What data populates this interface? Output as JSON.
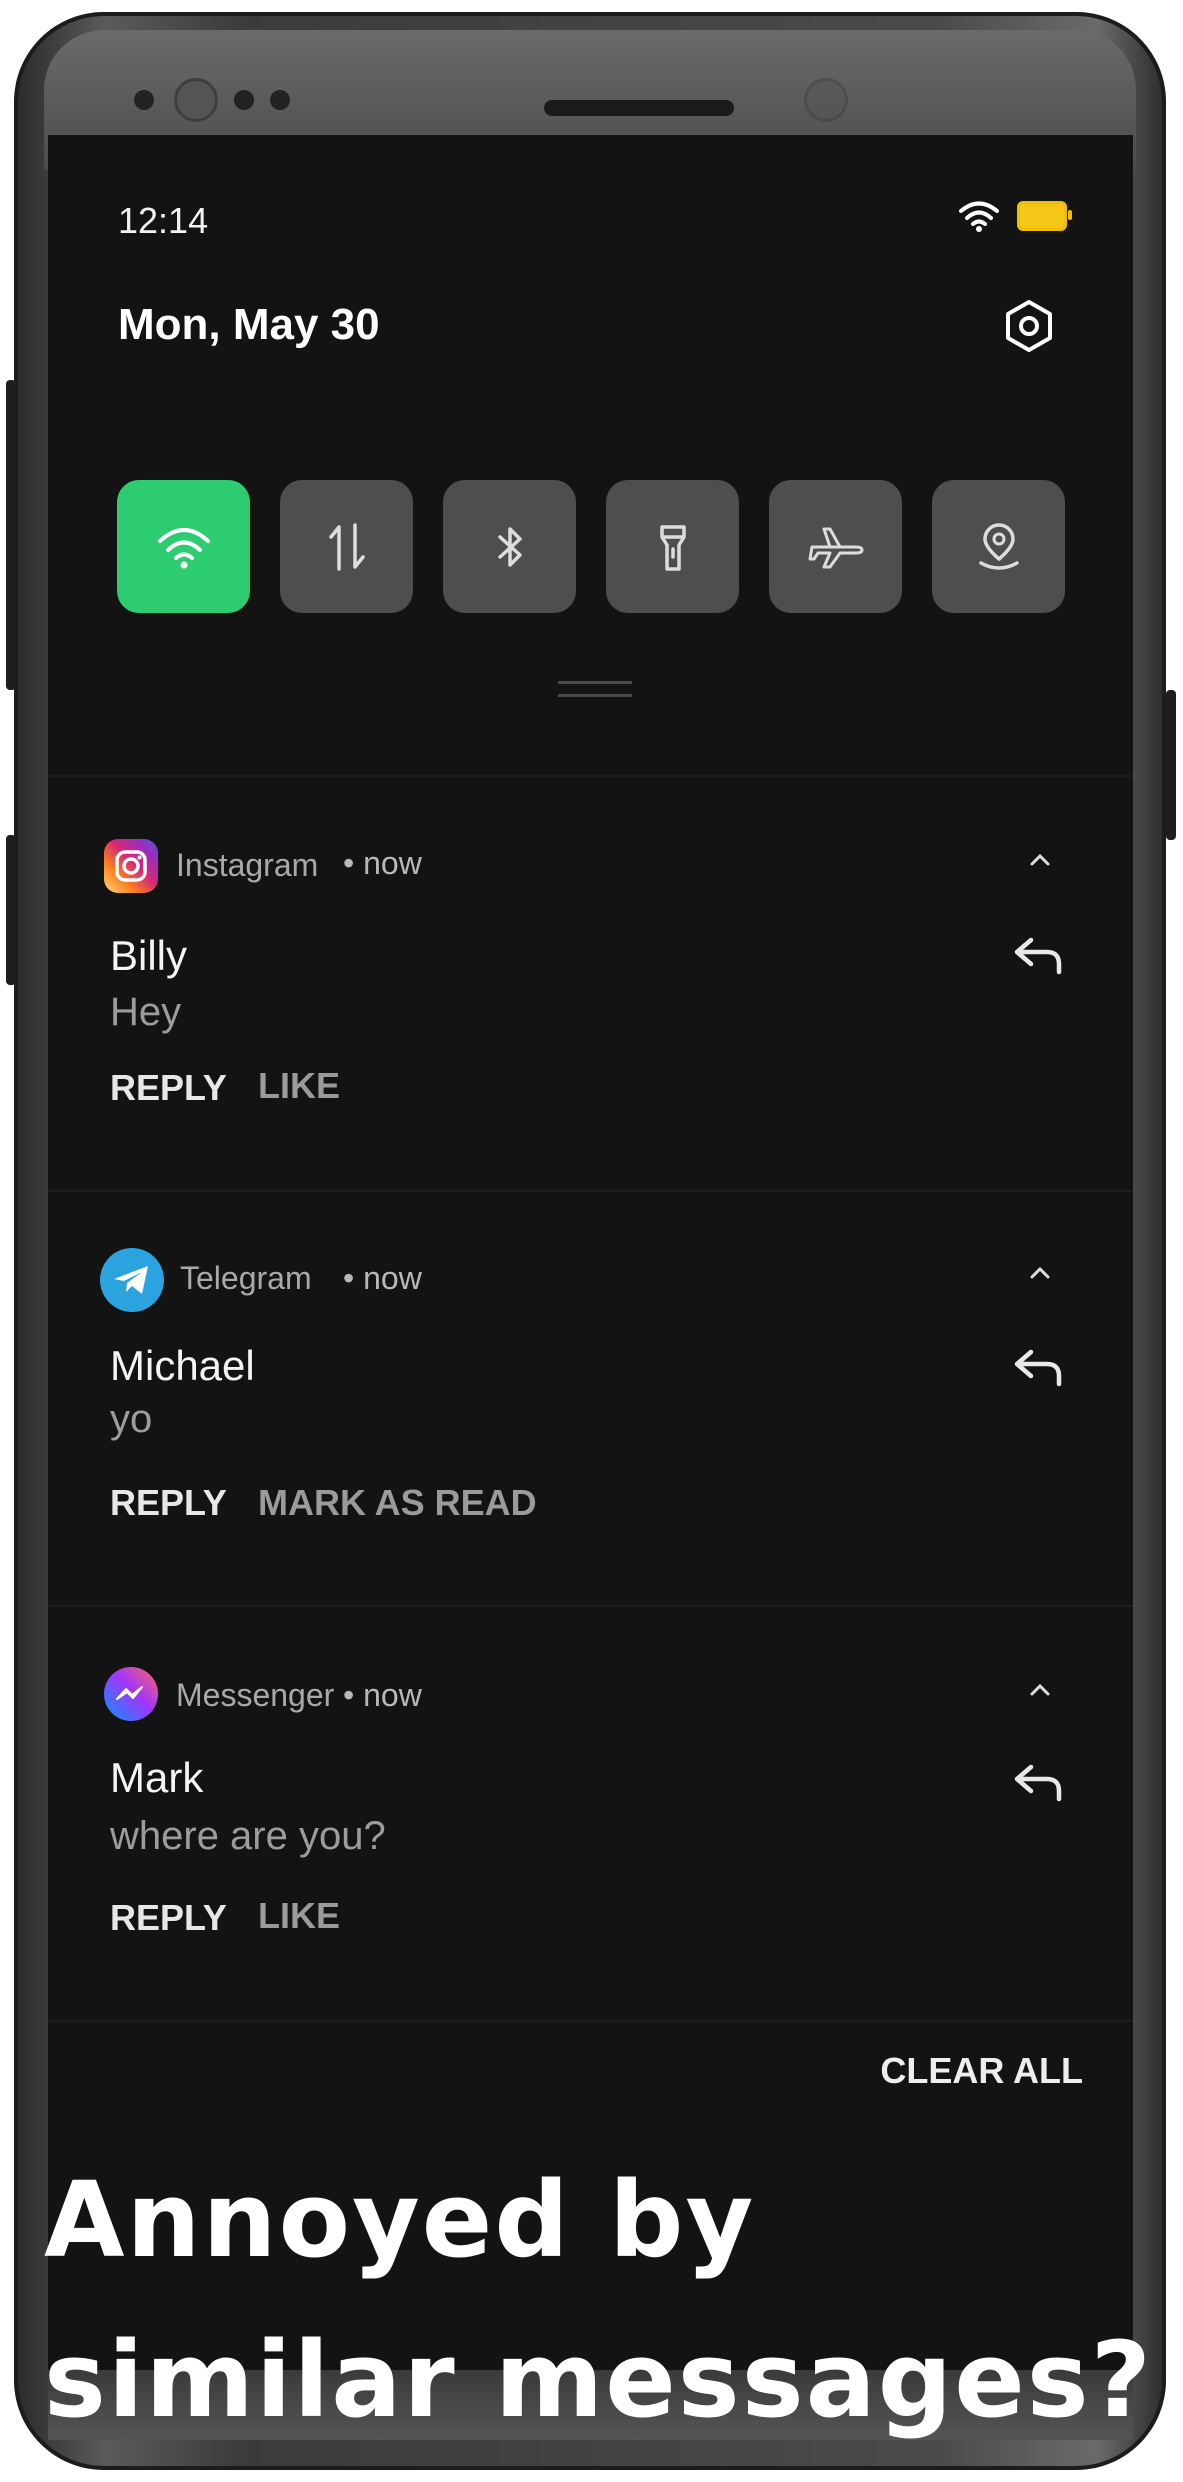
{
  "status_bar": {
    "time": "12:14",
    "wifi_icon": "wifi-icon",
    "battery_icon": "battery-icon",
    "battery_color": "#f5c518"
  },
  "header": {
    "date": "Mon, May 30",
    "settings_icon": "gear-icon"
  },
  "quick_settings": [
    {
      "icon": "wifi-icon",
      "active": true
    },
    {
      "icon": "mobile-data-icon",
      "active": false
    },
    {
      "icon": "bluetooth-icon",
      "active": false
    },
    {
      "icon": "flashlight-icon",
      "active": false
    },
    {
      "icon": "airplane-icon",
      "active": false
    },
    {
      "icon": "location-icon",
      "active": false
    }
  ],
  "accent_color": "#2ecc71",
  "notifications": [
    {
      "app": "Instagram",
      "time": "• now",
      "sender": "Billy",
      "message": "Hey",
      "actions": [
        "REPLY",
        "LIKE"
      ]
    },
    {
      "app": "Telegram",
      "time": "• now",
      "sender": "Michael",
      "message": "yo",
      "actions": [
        "REPLY",
        "MARK AS READ"
      ]
    },
    {
      "app": "Messenger",
      "time": "• now",
      "sender": "Mark",
      "message": "where are you?",
      "actions": [
        "REPLY",
        "LIKE"
      ]
    }
  ],
  "clear_all_label": "CLEAR ALL",
  "caption": {
    "line1": "Annoyed by",
    "line2": "similar messages?"
  }
}
